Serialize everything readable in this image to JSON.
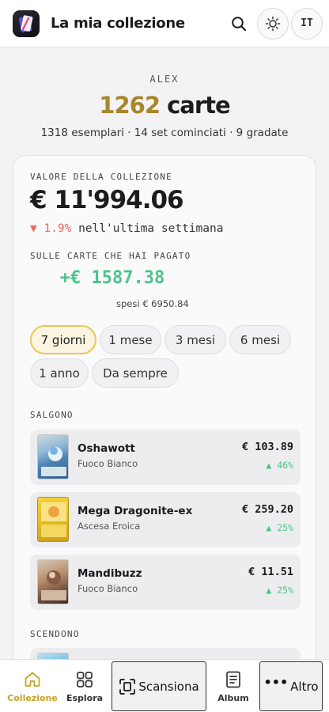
{
  "header": {
    "title": "La mia collezione",
    "search_icon": "search-icon",
    "theme_icon": "sun-icon",
    "language": "IT"
  },
  "profile": {
    "username": "ALEX",
    "card_count": "1262",
    "cards_word": "carte",
    "stats": "1318 esemplari · 14 set cominciati · 9 gradate"
  },
  "value": {
    "label": "VALORE DELLA COLLEZIONE",
    "amount": "€ 11'994.06",
    "change_arrow": "▼",
    "change_pct": "1.9%",
    "change_text": "nell'ultima settimana",
    "paid_label": "SULLE CARTE CHE HAI PAGATO",
    "profit": "+€ 1587.38",
    "spent": "spesi € 6950.84",
    "colors": {
      "gold": "#a8862a",
      "up": "#4cc38a",
      "down": "#e76a5b"
    }
  },
  "periods": {
    "options": [
      "7 giorni",
      "1 mese",
      "3 mesi",
      "6 mesi",
      "1 anno",
      "Da sempre"
    ],
    "selected": "7 giorni"
  },
  "rising": {
    "label": "SALGONO",
    "items": [
      {
        "name": "Oshawott",
        "set": "Fuoco Bianco",
        "price": "€ 103.89",
        "change": "▲ 46%"
      },
      {
        "name": "Mega Dragonite-ex",
        "set": "Ascesa Eroica",
        "price": "€ 259.20",
        "change": "▲ 25%"
      },
      {
        "name": "Mandibuzz",
        "set": "Fuoco Bianco",
        "price": "€ 11.51",
        "change": "▲ 25%"
      }
    ]
  },
  "falling": {
    "label": "SCENDONO"
  },
  "nav": {
    "collection": "Collezione",
    "explore": "Esplora",
    "scan": "Scansiona",
    "album": "Album",
    "more": "Altro"
  }
}
